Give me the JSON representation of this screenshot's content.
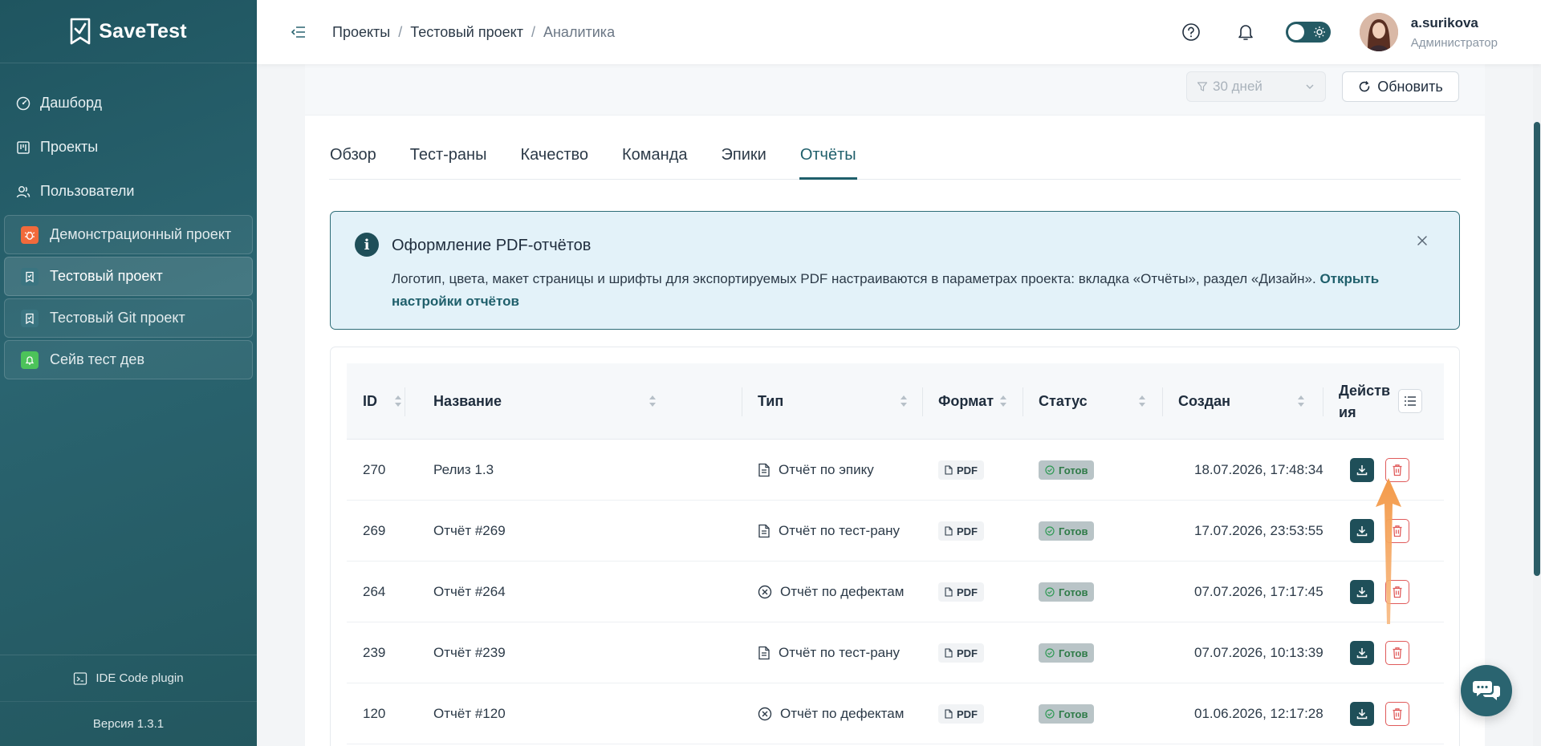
{
  "app": {
    "name": "SaveTest",
    "version": "Версия 1.3.1",
    "plugin": "IDE Code plugin"
  },
  "nav": [
    {
      "label": "Дашборд",
      "icon": "dashboard-icon"
    },
    {
      "label": "Проекты",
      "icon": "projects-icon"
    },
    {
      "label": "Пользователи",
      "icon": "users-icon"
    }
  ],
  "projects": [
    {
      "label": "Демонстрационный проект",
      "color": "#f26a3b",
      "icon": "bug-icon"
    },
    {
      "label": "Тестовый проект",
      "color": "#3a7480",
      "icon": "clipboard-icon"
    },
    {
      "label": "Тестовый Git проект",
      "color": "#3a7480",
      "icon": "clipboard-icon"
    },
    {
      "label": "Сейв тест дев",
      "color": "#4cc35a",
      "icon": "bell-icon"
    }
  ],
  "breadcrumb": [
    "Проекты",
    "Тестовый проект",
    "Аналитика"
  ],
  "breadcrumb_sep": "/",
  "user": {
    "name": "a.surikova",
    "role": "Администратор"
  },
  "toolbar": {
    "filter": "30 дней",
    "refresh": "Обновить"
  },
  "tabs": [
    "Обзор",
    "Тест-раны",
    "Качество",
    "Команда",
    "Эпики",
    "Отчёты"
  ],
  "info": {
    "title": "Оформление PDF-отчётов",
    "text": "Логотип, цвета, макет страницы и шрифты для экспортируемых PDF настраиваются в параметрах проекта: вкладка «Отчёты», раздел «Дизайн». ",
    "link": "Открыть настройки отчётов"
  },
  "table": {
    "headers": {
      "id": "ID",
      "name": "Название",
      "type": "Тип",
      "format": "Формат",
      "status": "Статус",
      "created": "Создан",
      "actions": "Действия"
    },
    "rows": [
      {
        "id": "270",
        "name": "Релиз 1.3",
        "type": "Отчёт по эпику",
        "type_icon": "document-icon",
        "format": "PDF",
        "status": "Готов",
        "created": "18.07.2026, 17:48:34"
      },
      {
        "id": "269",
        "name": "Отчёт #269",
        "type": "Отчёт по тест-рану",
        "type_icon": "document-icon",
        "format": "PDF",
        "status": "Готов",
        "created": "17.07.2026, 23:53:55"
      },
      {
        "id": "264",
        "name": "Отчёт #264",
        "type": "Отчёт по дефектам",
        "type_icon": "circle-x-icon",
        "format": "PDF",
        "status": "Готов",
        "created": "07.07.2026, 17:17:45"
      },
      {
        "id": "239",
        "name": "Отчёт #239",
        "type": "Отчёт по тест-рану",
        "type_icon": "document-icon",
        "format": "PDF",
        "status": "Готов",
        "created": "07.07.2026, 10:13:39"
      },
      {
        "id": "120",
        "name": "Отчёт #120",
        "type": "Отчёт по дефектам",
        "type_icon": "circle-x-icon",
        "format": "PDF",
        "status": "Готов",
        "created": "01.06.2026, 12:17:28"
      }
    ]
  },
  "colors": {
    "primary": "#1f4f59",
    "accent": "#2a6470",
    "danger": "#e05b5b",
    "annotation": "#f39a4a"
  }
}
